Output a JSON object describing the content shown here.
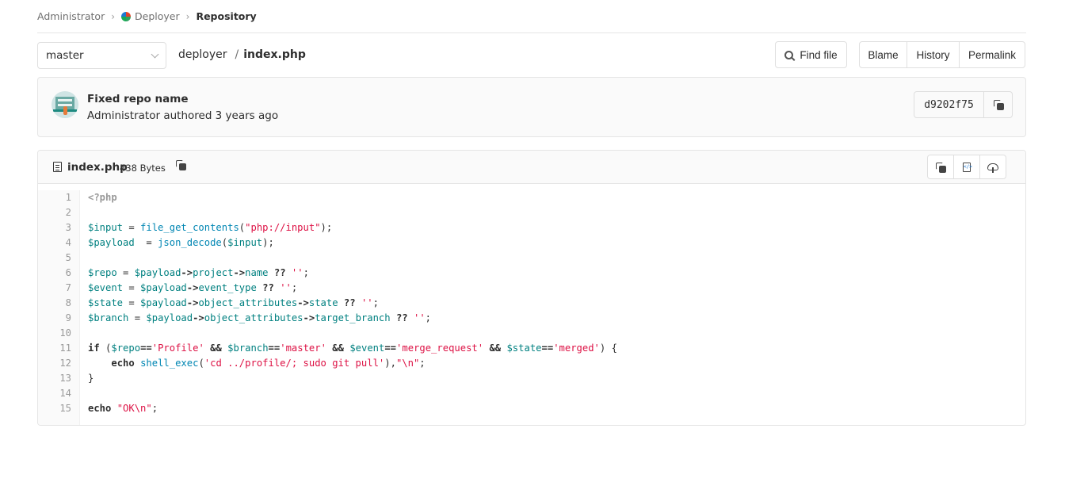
{
  "breadcrumbs": {
    "items": [
      {
        "label": "Administrator"
      },
      {
        "label": "Deployer",
        "icon": "project-avatar-icon"
      },
      {
        "label": "Repository",
        "current": true
      }
    ],
    "separator": "›"
  },
  "toolbar": {
    "branch": "master",
    "path_root": "deployer",
    "path_separator": "/",
    "path_file": "index.php",
    "find_file_label": "Find file",
    "blame_label": "Blame",
    "history_label": "History",
    "permalink_label": "Permalink"
  },
  "commit": {
    "title": "Fixed repo name",
    "meta": "Administrator authored 3 years ago",
    "sha": "d9202f75"
  },
  "file": {
    "name": "index.php",
    "size": "438 Bytes",
    "actions": [
      "copy-source-icon",
      "open-raw-icon",
      "download-icon"
    ],
    "line_numbers": [
      "1",
      "2",
      "3",
      "4",
      "5",
      "6",
      "7",
      "8",
      "9",
      "10",
      "11",
      "12",
      "13",
      "14",
      "15"
    ],
    "lines": [
      [
        {
          "t": "php",
          "v": "<?php"
        }
      ],
      [],
      [
        {
          "t": "var",
          "v": "$input"
        },
        {
          "t": "",
          "v": " = "
        },
        {
          "t": "fn",
          "v": "file_get_contents"
        },
        {
          "t": "",
          "v": "("
        },
        {
          "t": "str",
          "v": "\"php://input\""
        },
        {
          "t": "",
          "v": ");"
        }
      ],
      [
        {
          "t": "var",
          "v": "$payload"
        },
        {
          "t": "",
          "v": "  = "
        },
        {
          "t": "fn",
          "v": "json_decode"
        },
        {
          "t": "",
          "v": "("
        },
        {
          "t": "var",
          "v": "$input"
        },
        {
          "t": "",
          "v": ");"
        }
      ],
      [],
      [
        {
          "t": "var",
          "v": "$repo"
        },
        {
          "t": "",
          "v": " = "
        },
        {
          "t": "var",
          "v": "$payload"
        },
        {
          "t": "op",
          "v": "->"
        },
        {
          "t": "prop",
          "v": "project"
        },
        {
          "t": "op",
          "v": "->"
        },
        {
          "t": "prop",
          "v": "name"
        },
        {
          "t": "",
          "v": " "
        },
        {
          "t": "op",
          "v": "??"
        },
        {
          "t": "",
          "v": " "
        },
        {
          "t": "str",
          "v": "''"
        },
        {
          "t": "",
          "v": ";"
        }
      ],
      [
        {
          "t": "var",
          "v": "$event"
        },
        {
          "t": "",
          "v": " = "
        },
        {
          "t": "var",
          "v": "$payload"
        },
        {
          "t": "op",
          "v": "->"
        },
        {
          "t": "prop",
          "v": "event_type"
        },
        {
          "t": "",
          "v": " "
        },
        {
          "t": "op",
          "v": "??"
        },
        {
          "t": "",
          "v": " "
        },
        {
          "t": "str",
          "v": "''"
        },
        {
          "t": "",
          "v": ";"
        }
      ],
      [
        {
          "t": "var",
          "v": "$state"
        },
        {
          "t": "",
          "v": " = "
        },
        {
          "t": "var",
          "v": "$payload"
        },
        {
          "t": "op",
          "v": "->"
        },
        {
          "t": "prop",
          "v": "object_attributes"
        },
        {
          "t": "op",
          "v": "->"
        },
        {
          "t": "prop",
          "v": "state"
        },
        {
          "t": "",
          "v": " "
        },
        {
          "t": "op",
          "v": "??"
        },
        {
          "t": "",
          "v": " "
        },
        {
          "t": "str",
          "v": "''"
        },
        {
          "t": "",
          "v": ";"
        }
      ],
      [
        {
          "t": "var",
          "v": "$branch"
        },
        {
          "t": "",
          "v": " = "
        },
        {
          "t": "var",
          "v": "$payload"
        },
        {
          "t": "op",
          "v": "->"
        },
        {
          "t": "prop",
          "v": "object_attributes"
        },
        {
          "t": "op",
          "v": "->"
        },
        {
          "t": "prop",
          "v": "target_branch"
        },
        {
          "t": "",
          "v": " "
        },
        {
          "t": "op",
          "v": "??"
        },
        {
          "t": "",
          "v": " "
        },
        {
          "t": "str",
          "v": "''"
        },
        {
          "t": "",
          "v": ";"
        }
      ],
      [],
      [
        {
          "t": "kw",
          "v": "if"
        },
        {
          "t": "",
          "v": " ("
        },
        {
          "t": "var",
          "v": "$repo"
        },
        {
          "t": "op",
          "v": "=="
        },
        {
          "t": "str",
          "v": "'Profile'"
        },
        {
          "t": "",
          "v": " "
        },
        {
          "t": "op",
          "v": "&&"
        },
        {
          "t": "",
          "v": " "
        },
        {
          "t": "var",
          "v": "$branch"
        },
        {
          "t": "op",
          "v": "=="
        },
        {
          "t": "str",
          "v": "'master'"
        },
        {
          "t": "",
          "v": " "
        },
        {
          "t": "op",
          "v": "&&"
        },
        {
          "t": "",
          "v": " "
        },
        {
          "t": "var",
          "v": "$event"
        },
        {
          "t": "op",
          "v": "=="
        },
        {
          "t": "str",
          "v": "'merge_request'"
        },
        {
          "t": "",
          "v": " "
        },
        {
          "t": "op",
          "v": "&&"
        },
        {
          "t": "",
          "v": " "
        },
        {
          "t": "var",
          "v": "$state"
        },
        {
          "t": "op",
          "v": "=="
        },
        {
          "t": "str",
          "v": "'merged'"
        },
        {
          "t": "",
          "v": ") {"
        }
      ],
      [
        {
          "t": "",
          "v": "    "
        },
        {
          "t": "kw",
          "v": "echo"
        },
        {
          "t": "",
          "v": " "
        },
        {
          "t": "fn",
          "v": "shell_exec"
        },
        {
          "t": "",
          "v": "("
        },
        {
          "t": "str",
          "v": "'cd ../profile/; sudo git pull'"
        },
        {
          "t": "",
          "v": "),"
        },
        {
          "t": "str",
          "v": "\"\\n\""
        },
        {
          "t": "",
          "v": ";"
        }
      ],
      [
        {
          "t": "",
          "v": "}"
        }
      ],
      [],
      [
        {
          "t": "kw",
          "v": "echo"
        },
        {
          "t": "",
          "v": " "
        },
        {
          "t": "str",
          "v": "\"OK\\n\""
        },
        {
          "t": "",
          "v": ";"
        }
      ]
    ]
  }
}
